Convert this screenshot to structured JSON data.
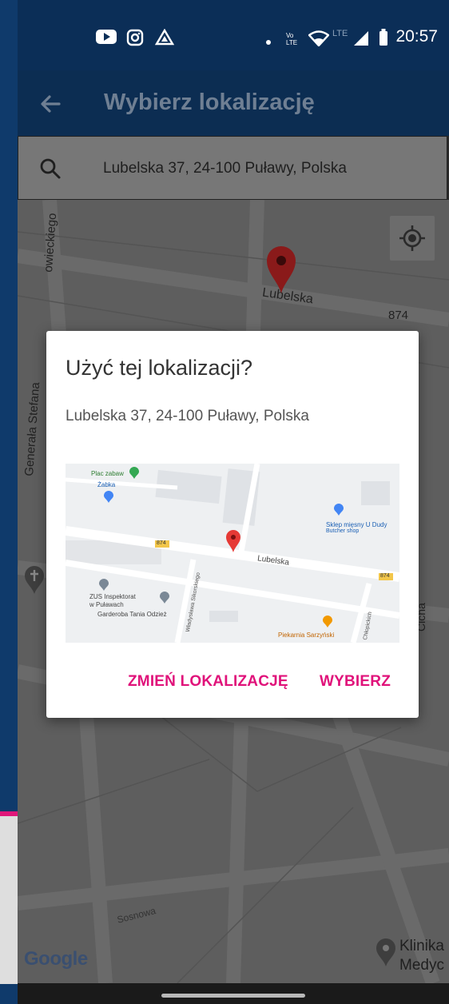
{
  "status_bar": {
    "time": "20:57",
    "network": "LTE"
  },
  "app_bar": {
    "title": "Wybierz lokalizację"
  },
  "search": {
    "value": "Lubelska 37, 24-100 Puławy, Polska"
  },
  "map": {
    "labels": {
      "street_main": "Lubelska",
      "road_number": "874",
      "street_left_top": "owieckiego",
      "street_left": "Generała Stefana",
      "street_bottom": "Sosnowa",
      "street_right": "Cicha",
      "poi_clinic_line1": "Klinika",
      "poi_clinic_line2": "Medyc"
    },
    "logo": "Google"
  },
  "dialog": {
    "title": "Użyć tej lokalizacji?",
    "address": "Lubelska 37, 24-100 Puławy, Polska",
    "preview": {
      "poi_playground": "Plac zabaw",
      "poi_zabka": "Żabka",
      "poi_butcher": "Sklep mięsny U Dudy",
      "poi_butcher_sub": "Butcher shop",
      "road_number": "874",
      "street": "Lubelska",
      "poi_zus_line1": "ZUS Inspektorat",
      "poi_zus_line2": "w Puławach",
      "poi_garderoba": "Garderoba Tania Odzież",
      "street_vertical": "Władysława Sikorskiego",
      "street_vertical2": "Chłopickich",
      "poi_bakery": "Piekarnia Sarzyński"
    },
    "buttons": {
      "change": "ZMIEŃ LOKALIZACJĘ",
      "choose": "WYBIERZ"
    }
  },
  "colors": {
    "accent": "#e0127a",
    "status_bar": "#0b2e57",
    "app_bar": "#0c2d52",
    "marker": "#d93a3a"
  }
}
